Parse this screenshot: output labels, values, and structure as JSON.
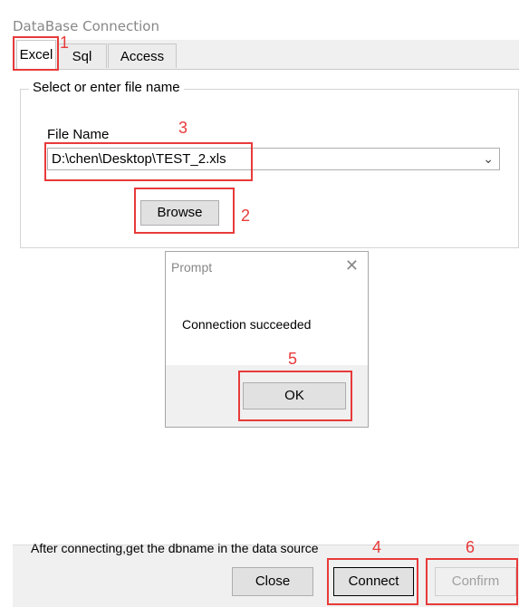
{
  "window": {
    "title": "DataBase Connection"
  },
  "tabs": [
    {
      "label": "Excel"
    },
    {
      "label": "Sql"
    },
    {
      "label": "Access"
    }
  ],
  "group": {
    "legend": "Select or enter file name",
    "file_label": "File Name",
    "file_value": "D:\\chen\\Desktop\\TEST_2.xls",
    "browse_label": "Browse"
  },
  "dialog": {
    "title": "Prompt",
    "close_glyph": "✕",
    "message": "Connection succeeded",
    "ok_label": "OK"
  },
  "footer": {
    "note": "After connecting,get the dbname in the data source",
    "close_label": "Close",
    "connect_label": "Connect",
    "confirm_label": "Confirm"
  },
  "annotations": {
    "n1": "1",
    "n2": "2",
    "n3": "3",
    "n4": "4",
    "n5": "5",
    "n6": "6",
    "color": "#e83a3a"
  }
}
